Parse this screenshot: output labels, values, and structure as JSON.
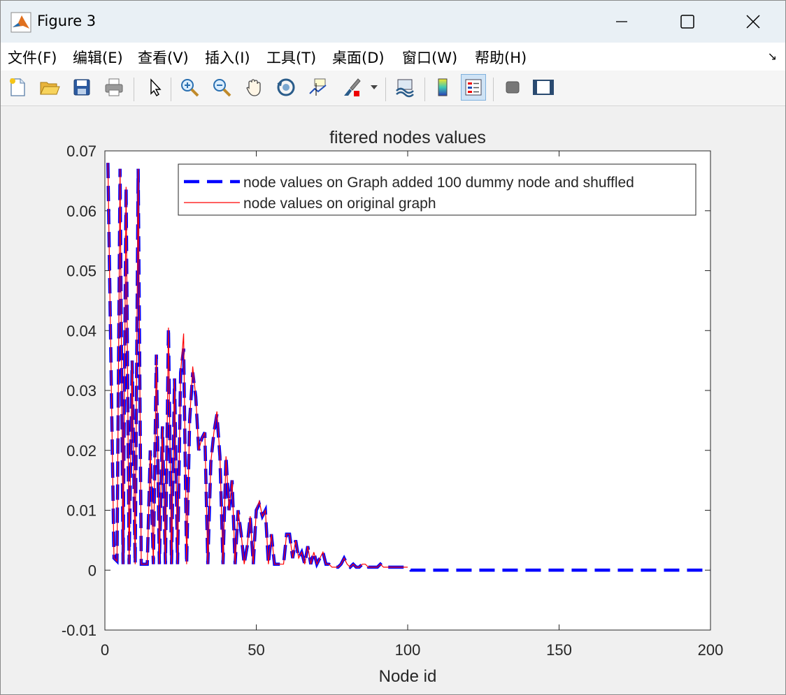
{
  "window": {
    "title": "Figure 3"
  },
  "menu": {
    "items": [
      {
        "label": "文件(F)"
      },
      {
        "label": "编辑(E)"
      },
      {
        "label": "查看(V)"
      },
      {
        "label": "插入(I)"
      },
      {
        "label": "工具(T)"
      },
      {
        "label": "桌面(D)"
      },
      {
        "label": "窗口(W)"
      },
      {
        "label": "帮助(H)"
      }
    ]
  },
  "toolbar": {
    "icons": [
      "new-file-icon",
      "open-folder-icon",
      "save-icon",
      "print-icon",
      "select-arrow-icon",
      "zoom-in-icon",
      "zoom-out-icon",
      "pan-hand-icon",
      "rotate-3d-icon",
      "data-cursor-icon",
      "brush-icon",
      "link-plot-icon",
      "colorbar-icon",
      "legend-icon",
      "hide-plot-tools-icon",
      "show-plot-tools-icon"
    ]
  },
  "chart_data": {
    "type": "line",
    "title": "fitered nodes values",
    "xlabel": "Node id",
    "ylabel": "",
    "xlim": [
      0,
      200
    ],
    "ylim": [
      -0.01,
      0.07
    ],
    "xticks": [
      "0",
      "50",
      "100",
      "150",
      "200"
    ],
    "yticks": [
      "-0.01",
      "0",
      "0.01",
      "0.02",
      "0.03",
      "0.04",
      "0.05",
      "0.06",
      "0.07"
    ],
    "grid": false,
    "legend_position": "top-right",
    "series": [
      {
        "name": "node values on Graph added 100 dummy node and shuffled",
        "style": "dashed",
        "color": "#0000ff",
        "x": [
          1,
          2,
          3,
          4,
          5,
          6,
          7,
          8,
          9,
          10,
          11,
          12,
          13,
          14,
          15,
          16,
          17,
          18,
          19,
          20,
          21,
          22,
          23,
          24,
          25,
          26,
          27,
          28,
          29,
          30,
          31,
          32,
          33,
          34,
          35,
          36,
          37,
          38,
          39,
          40,
          41,
          42,
          43,
          44,
          45,
          46,
          47,
          48,
          49,
          50,
          51,
          52,
          53,
          54,
          55,
          56,
          57,
          58,
          59,
          60,
          61,
          62,
          63,
          64,
          65,
          66,
          67,
          68,
          69,
          70,
          71,
          72,
          73,
          74,
          75,
          76,
          77,
          78,
          79,
          80,
          81,
          82,
          83,
          84,
          85,
          86,
          87,
          88,
          89,
          90,
          91,
          92,
          93,
          94,
          95,
          96,
          97,
          98,
          99,
          100,
          101,
          200
        ],
        "values": [
          0.068,
          0.0345,
          0.002,
          0.0015,
          0.067,
          0.001,
          0.064,
          0.001,
          0.035,
          0.001,
          0.067,
          0.001,
          0.001,
          0.001,
          0.02,
          0.001,
          0.036,
          0.001,
          0.024,
          0.001,
          0.0405,
          0.001,
          0.032,
          0.001,
          0.033,
          0.037,
          0.001,
          0.025,
          0.033,
          0.029,
          0.02,
          0.022,
          0.023,
          0.001,
          0.018,
          0.023,
          0.026,
          0.019,
          0.001,
          0.019,
          0.01,
          0.015,
          0.001,
          0.01,
          0.006,
          0.001,
          0.004,
          0.009,
          0.001,
          0.01,
          0.011,
          0.009,
          0.01,
          0.001,
          0.006,
          0.001,
          0.001,
          0.001,
          0.001,
          0.006,
          0.006,
          0.002,
          0.005,
          0.002,
          0.003,
          0.001,
          0.004,
          0.001,
          0.003,
          0.001,
          0.002,
          0.003,
          0.001,
          0.001,
          0.0005,
          0.0005,
          0.0005,
          0.001,
          0.002,
          0.001,
          0.0005,
          0.001,
          0.0005,
          0.0005,
          0.001,
          0.001,
          0.0005,
          0.0005,
          0.0005,
          0.0005,
          0.001,
          0.0005,
          0.0005,
          0.0005,
          0.0005,
          0.0005,
          0.0005,
          0.0005,
          0.0005,
          0.0005,
          0,
          0
        ]
      },
      {
        "name": "node values on original graph",
        "style": "solid",
        "color": "#ff0000",
        "x": [
          1,
          2,
          3,
          4,
          5,
          6,
          7,
          8,
          9,
          10,
          11,
          12,
          13,
          14,
          15,
          16,
          17,
          18,
          19,
          20,
          21,
          22,
          23,
          24,
          25,
          26,
          27,
          28,
          29,
          30,
          31,
          32,
          33,
          34,
          35,
          36,
          37,
          38,
          39,
          40,
          41,
          42,
          43,
          44,
          45,
          46,
          47,
          48,
          49,
          50,
          51,
          52,
          53,
          54,
          55,
          56,
          57,
          58,
          59,
          60,
          61,
          62,
          63,
          64,
          65,
          66,
          67,
          68,
          69,
          70,
          71,
          72,
          73,
          74,
          75,
          76,
          77,
          78,
          79,
          80,
          81,
          82,
          83,
          84,
          85,
          86,
          87,
          88,
          89,
          90,
          91,
          92,
          93,
          94,
          95,
          96,
          97,
          98,
          99,
          100
        ],
        "values": [
          0.068,
          0.0345,
          0.002,
          0.0015,
          0.067,
          0.001,
          0.064,
          0.001,
          0.035,
          0.001,
          0.067,
          0.001,
          0.001,
          0.001,
          0.02,
          0.001,
          0.036,
          0.001,
          0.024,
          0.001,
          0.0405,
          0.001,
          0.032,
          0.001,
          0.033,
          0.0395,
          0.001,
          0.025,
          0.034,
          0.029,
          0.02,
          0.022,
          0.023,
          0.001,
          0.018,
          0.023,
          0.0265,
          0.019,
          0.001,
          0.019,
          0.01,
          0.015,
          0.001,
          0.01,
          0.006,
          0.001,
          0.004,
          0.009,
          0.001,
          0.01,
          0.0115,
          0.009,
          0.01,
          0.001,
          0.006,
          0.001,
          0.001,
          0.001,
          0.001,
          0.006,
          0.006,
          0.002,
          0.005,
          0.002,
          0.003,
          0.001,
          0.004,
          0.001,
          0.003,
          0.001,
          0.002,
          0.003,
          0.001,
          0.001,
          0.0005,
          0.0005,
          0.0005,
          0.001,
          0.002,
          0.001,
          0.0005,
          0.001,
          0.0005,
          0.0005,
          0.001,
          0.001,
          0.0005,
          0.0005,
          0.0005,
          0.0005,
          0.001,
          0.0005,
          0.0005,
          0.0005,
          0.0005,
          0.0005,
          0.0005,
          0.0005,
          0.0005,
          0.0005
        ]
      }
    ]
  }
}
